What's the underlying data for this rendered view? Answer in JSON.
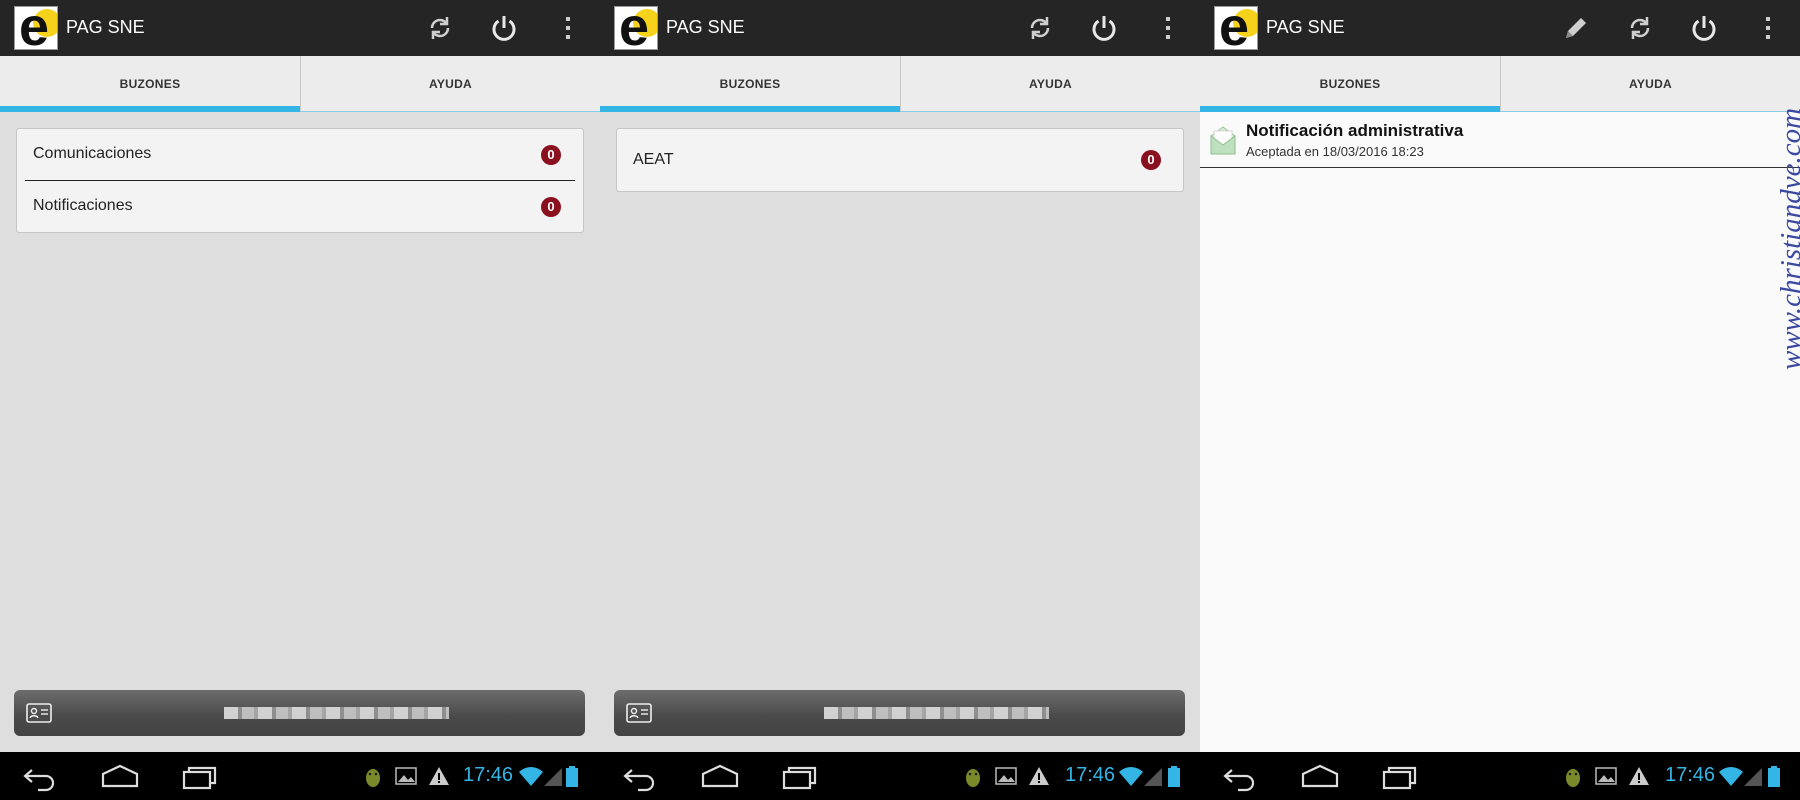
{
  "app": {
    "title": "PAG SNE",
    "logo_letter": "e"
  },
  "tabs": {
    "mailboxes": "BUZONES",
    "help": "AYUDA"
  },
  "panel1": {
    "rows": [
      {
        "label": "Comunicaciones",
        "count": "0"
      },
      {
        "label": "Notificaciones",
        "count": "0"
      }
    ]
  },
  "panel2": {
    "rows": [
      {
        "label": "AEAT",
        "count": "0"
      }
    ]
  },
  "panel3": {
    "notification": {
      "title": "Notificación administrativa",
      "subtitle": "Aceptada en 18/03/2016 18:23"
    },
    "watermark": "www.christiandve.com"
  },
  "status": {
    "time": "17:46"
  },
  "colors": {
    "accent": "#33b5e5",
    "badge": "#8a1020",
    "actionbar": "#252525"
  }
}
